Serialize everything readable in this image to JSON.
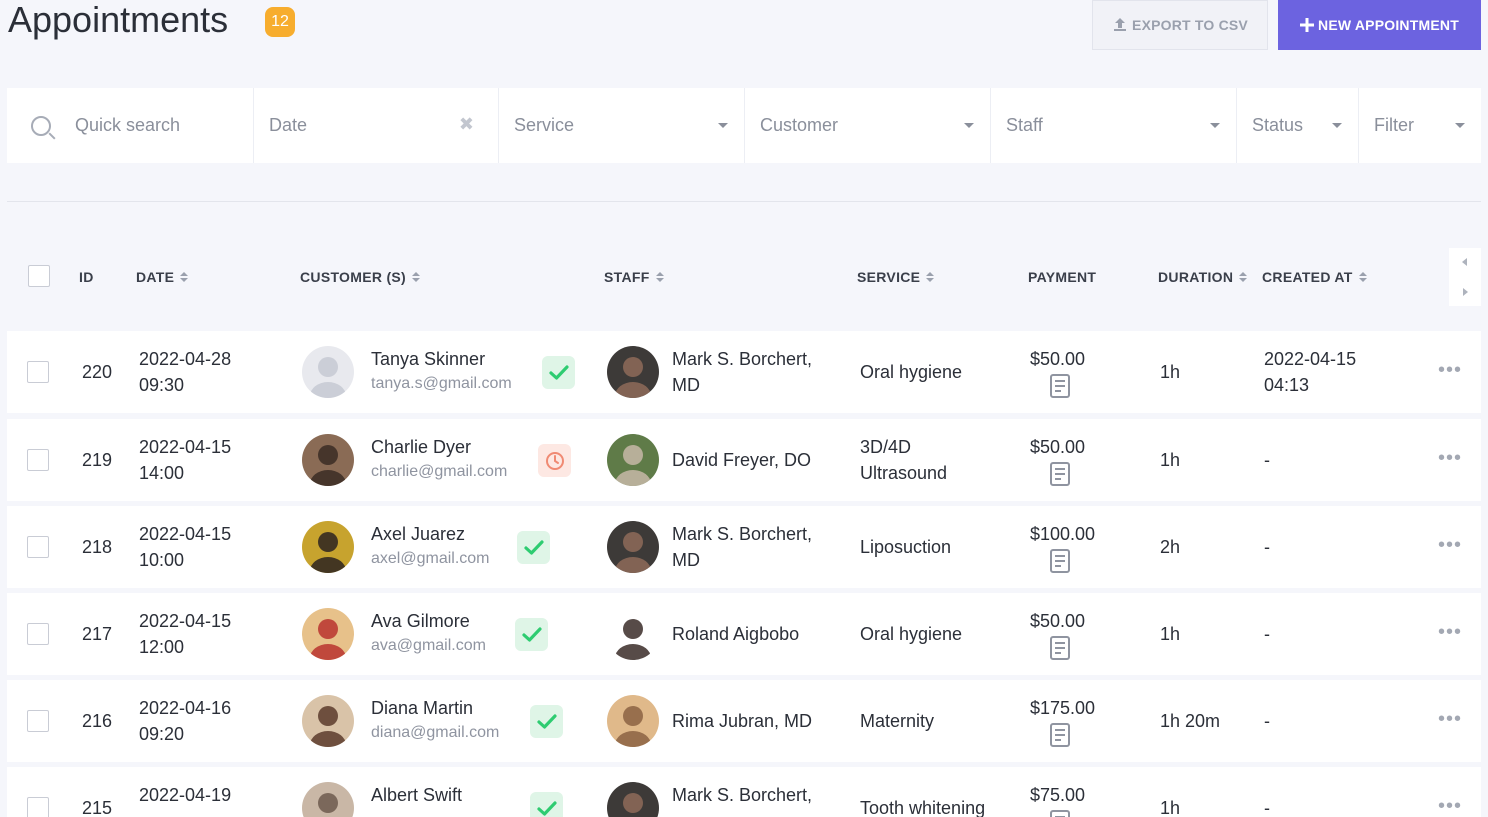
{
  "header": {
    "title": "Appointments",
    "count": "12",
    "export_label": "EXPORT TO CSV",
    "new_label": "NEW APPOINTMENT"
  },
  "filters": {
    "search_placeholder": "Quick search",
    "date": "Date",
    "service": "Service",
    "customer": "Customer",
    "staff": "Staff",
    "status": "Status",
    "filter": "Filter"
  },
  "columns": {
    "id": "ID",
    "date": "DATE",
    "customers": "CUSTOMER (S)",
    "staff": "STAFF",
    "service": "SERVICE",
    "payment": "PAYMENT",
    "duration": "DURATION",
    "created_at": "CREATED AT"
  },
  "colors": {
    "accent": "#6c63e0",
    "badge": "#f7ad2e",
    "approved": "#2ecc71",
    "pending": "#f08a73"
  },
  "rows": [
    {
      "id": "220",
      "date": "2022-04-28",
      "time": "09:30",
      "customer": "Tanya Skinner",
      "email": "tanya.s@gmail.com",
      "status": "approved",
      "staff_line1": "Mark S. Borchert,",
      "staff_line2": "MD",
      "service_line1": "Oral hygiene",
      "service_line2": "",
      "payment": "$50.00",
      "duration": "1h",
      "created_date": "2022-04-15",
      "created_time": "04:13"
    },
    {
      "id": "219",
      "date": "2022-04-15",
      "time": "14:00",
      "customer": "Charlie Dyer",
      "email": "charlie@gmail.com",
      "status": "pending",
      "staff_line1": "David Freyer, DO",
      "staff_line2": "",
      "service_line1": "3D/4D",
      "service_line2": "Ultrasound",
      "payment": "$50.00",
      "duration": "1h",
      "created_date": "-",
      "created_time": ""
    },
    {
      "id": "218",
      "date": "2022-04-15",
      "time": "10:00",
      "customer": "Axel Juarez",
      "email": "axel@gmail.com",
      "status": "approved",
      "staff_line1": "Mark S. Borchert,",
      "staff_line2": "MD",
      "service_line1": "Liposuction",
      "service_line2": "",
      "payment": "$100.00",
      "duration": "2h",
      "created_date": "-",
      "created_time": ""
    },
    {
      "id": "217",
      "date": "2022-04-15",
      "time": "12:00",
      "customer": "Ava Gilmore",
      "email": "ava@gmail.com",
      "status": "approved",
      "staff_line1": "Roland Aigbobo",
      "staff_line2": "",
      "service_line1": "Oral hygiene",
      "service_line2": "",
      "payment": "$50.00",
      "duration": "1h",
      "created_date": "-",
      "created_time": ""
    },
    {
      "id": "216",
      "date": "2022-04-16",
      "time": "09:20",
      "customer": "Diana Martin",
      "email": "diana@gmail.com",
      "status": "approved",
      "staff_line1": "Rima Jubran, MD",
      "staff_line2": "",
      "service_line1": "Maternity",
      "service_line2": "",
      "payment": "$175.00",
      "duration": "1h 20m",
      "created_date": "-",
      "created_time": ""
    },
    {
      "id": "215",
      "date": "2022-04-19",
      "time": "",
      "customer": "Albert Swift",
      "email": "",
      "status": "approved",
      "staff_line1": "Mark S. Borchert,",
      "staff_line2": "",
      "service_line1": "Tooth whitening",
      "service_line2": "",
      "payment": "$75.00",
      "duration": "1h",
      "created_date": "-",
      "created_time": ""
    }
  ]
}
